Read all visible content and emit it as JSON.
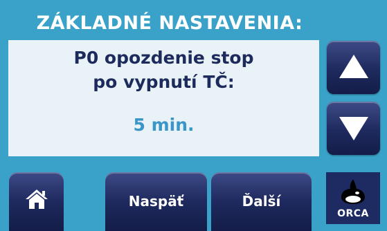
{
  "header": {
    "title": "ZÁKLADNÉ NASTAVENIA:"
  },
  "parameter": {
    "line1": "P0 opozdenie stop",
    "line2": "po vypnutí TČ:",
    "value": "5 min."
  },
  "nav": {
    "up_icon": "arrow-up-icon",
    "down_icon": "arrow-down-icon",
    "home_icon": "home-icon",
    "back_label": "Naspäť",
    "next_label": "Ďalší"
  },
  "brand": {
    "logo_text": "ORCA"
  },
  "colors": {
    "background": "#3aa2c9",
    "panel": "#e9f2f6",
    "text_dark": "#1d2b5c",
    "value_blue": "#3a95c8",
    "button": "#1e2a5e"
  }
}
